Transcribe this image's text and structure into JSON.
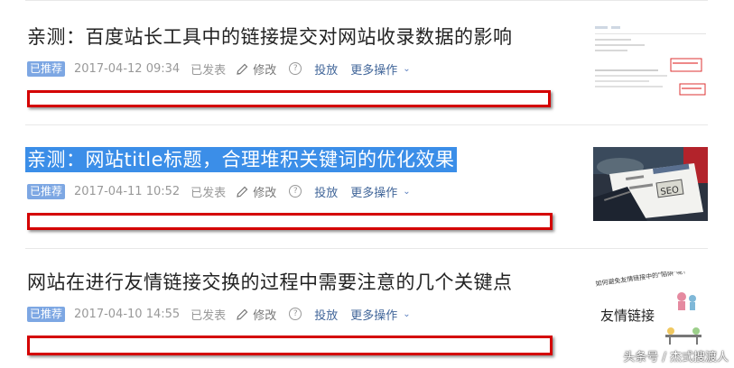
{
  "articles": [
    {
      "title": "亲测：百度站长工具中的链接提交对网站收录数据的影响",
      "badge": "已推荐",
      "datetime": "2017-04-12 09:34",
      "status": "已发表",
      "edit_label": "修改",
      "promote_label": "投放",
      "more_label": "更多操作",
      "selected": false
    },
    {
      "title": "亲测：网站title标题，合理堆积关键词的优化效果",
      "badge": "已推荐",
      "datetime": "2017-04-11 10:52",
      "status": "已发表",
      "edit_label": "修改",
      "promote_label": "投放",
      "more_label": "更多操作",
      "selected": true
    },
    {
      "title": "网站在进行友情链接交换的过程中需要注意的几个关键点",
      "badge": "已推荐",
      "datetime": "2017-04-10 14:55",
      "status": "已发表",
      "edit_label": "修改",
      "promote_label": "投放",
      "more_label": "更多操作",
      "selected": false
    }
  ],
  "thumbnails": {
    "third_caption": "友情链接",
    "third_top_text": "如何避免友情链接中的\"陷阱\"呢?",
    "second_text": "SEO"
  },
  "watermark": "头条号 / 杰式搜渡人",
  "icons": {
    "edit": "pencil-icon",
    "help": "question-circle-icon",
    "more": "chevron-down-icon"
  },
  "colors": {
    "badge": "#7da7e3",
    "link": "#406599",
    "selection": "#3b8ee8",
    "redbox": "#d40000"
  }
}
